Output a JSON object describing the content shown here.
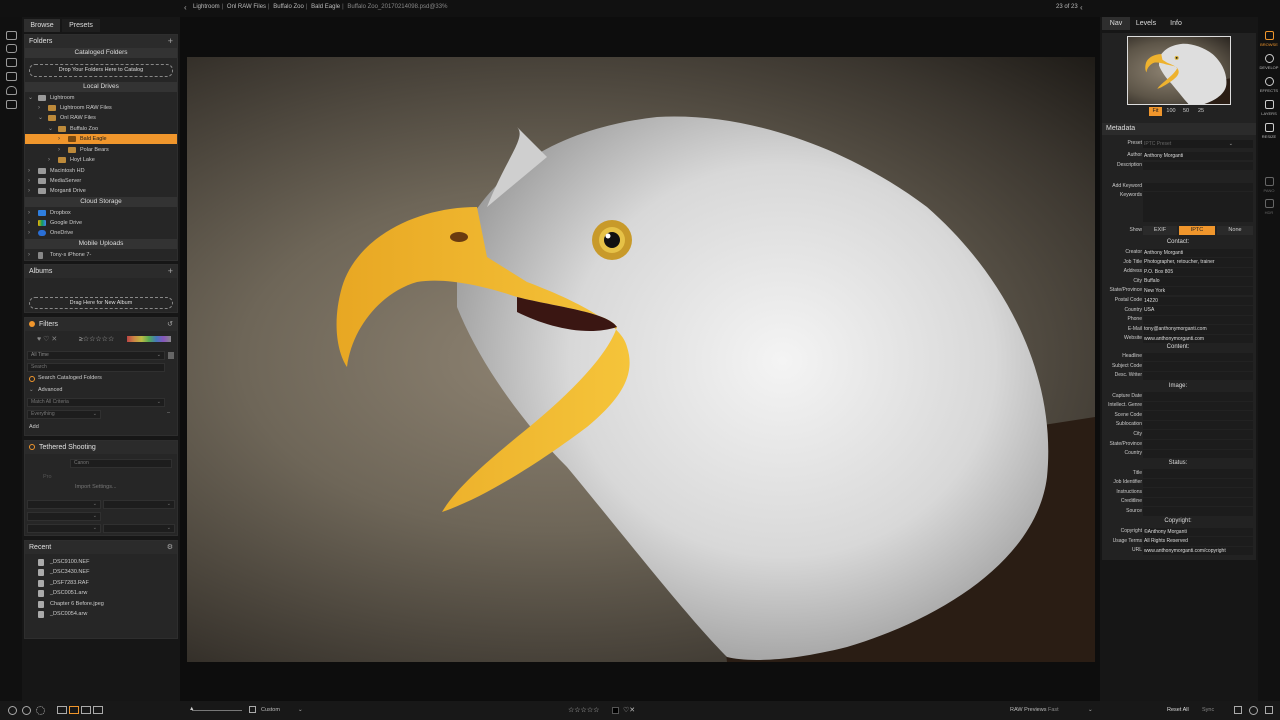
{
  "topbar": {
    "crumbs": [
      "Lightroom",
      "Onl RAW Files",
      "Buffalo Zoo",
      "Bald Eagle"
    ],
    "file": "Buffalo Zoo_20170214098.psd@33%",
    "counter": "23 of 23"
  },
  "left": {
    "tabs": [
      "Browse",
      "Presets"
    ],
    "folders": {
      "title": "Folders",
      "cataloged": "Cataloged Folders",
      "drop_catalog": "Drop Your Folders Here to Catalog",
      "local": "Local Drives",
      "tree": [
        {
          "label": "Lightroom"
        },
        {
          "label": "Lightroom RAW Files"
        },
        {
          "label": "Onl RAW Files"
        },
        {
          "label": "Buffalo Zoo"
        },
        {
          "label": "Bald Eagle"
        },
        {
          "label": "Polar Bears"
        },
        {
          "label": "Hoyt Lake"
        },
        {
          "label": "Macintosh HD"
        },
        {
          "label": "MediaServer"
        },
        {
          "label": "Morganti Drive"
        }
      ],
      "cloud": "Cloud Storage",
      "cloud_items": [
        {
          "label": "Dropbox"
        },
        {
          "label": "Google Drive"
        },
        {
          "label": "OneDrive"
        }
      ],
      "mobile": "Mobile Uploads",
      "mobile_items": [
        {
          "label": "Tony-s iPhone 7-"
        }
      ]
    },
    "albums": {
      "title": "Albums",
      "drop": "Drag Here for New Album"
    },
    "filters": {
      "title": "Filters",
      "rating": "≥☆☆☆☆☆",
      "time": "All Time",
      "search_placeholder": "Search",
      "search_cataloged": "Search Cataloged Folders",
      "advanced": "Advanced",
      "match": "Match All Criteria",
      "everything": "Everything",
      "add": "Add"
    },
    "tethered": {
      "title": "Tethered Shooting",
      "camera": "Canon",
      "import": "Import Settings..."
    },
    "recent": {
      "title": "Recent",
      "items": [
        "_DSC9100.NEF",
        "_DSC3430.NEF",
        "_DSF7283.RAF",
        "_DSC0051.arw",
        "Chapter 6 Before.jpeg",
        "_DSC0054.arw"
      ]
    }
  },
  "right": {
    "tabs": [
      "Nav",
      "Levels",
      "Info"
    ],
    "zoom": [
      "Fit",
      "100",
      "50",
      "25"
    ],
    "metadata_title": "Metadata",
    "preset_label": "Preset",
    "preset_value": "IPTC Preset",
    "top_fields": [
      {
        "k": "Author",
        "v": "Anthony Morganti"
      },
      {
        "k": "Description",
        "v": ""
      },
      {
        "k": "Add Keyword",
        "v": ""
      },
      {
        "k": "Keywords",
        "v": ""
      }
    ],
    "show_label": "Show",
    "show_opts": [
      "EXIF",
      "IPTC",
      "None"
    ],
    "contact_title": "Contact:",
    "contact": [
      {
        "k": "Creator",
        "v": "Anthony Morganti"
      },
      {
        "k": "Job Title",
        "v": "Photographer, retoucher, trainer"
      },
      {
        "k": "Address",
        "v": "P.O. Box 805"
      },
      {
        "k": "City",
        "v": "Buffalo"
      },
      {
        "k": "State/Province",
        "v": "New York"
      },
      {
        "k": "Postal Code",
        "v": "14220"
      },
      {
        "k": "Country",
        "v": "USA"
      },
      {
        "k": "Phone",
        "v": ""
      },
      {
        "k": "E-Mail",
        "v": "tony@anthonymorganti.com"
      },
      {
        "k": "Website",
        "v": "www.anthonymorganti.com"
      }
    ],
    "content_title": "Content:",
    "content": [
      {
        "k": "Headline",
        "v": ""
      },
      {
        "k": "Subject Code",
        "v": ""
      },
      {
        "k": "Desc. Writer",
        "v": ""
      }
    ],
    "image_title": "Image:",
    "image": [
      {
        "k": "Capture Date",
        "v": ""
      },
      {
        "k": "Intellect. Genre",
        "v": ""
      },
      {
        "k": "Scene Code",
        "v": ""
      },
      {
        "k": "Sublocation",
        "v": ""
      },
      {
        "k": "City",
        "v": ""
      },
      {
        "k": "State/Province",
        "v": ""
      },
      {
        "k": "Country",
        "v": ""
      }
    ],
    "status_title": "Status:",
    "status": [
      {
        "k": "Title",
        "v": ""
      },
      {
        "k": "Job Identifier",
        "v": ""
      },
      {
        "k": "Instructions",
        "v": ""
      },
      {
        "k": "Creditline",
        "v": ""
      },
      {
        "k": "Source",
        "v": ""
      }
    ],
    "copyright_title": "Copyright:",
    "copyright": [
      {
        "k": "Copyright",
        "v": "©Anthony Morganti"
      },
      {
        "k": "Usage Terms",
        "v": "All Rights Reserved"
      },
      {
        "k": "URL",
        "v": "www.anthonymorganti.com/copyright"
      }
    ]
  },
  "modules": [
    {
      "label": "BROWSE",
      "icon": "browse-icon"
    },
    {
      "label": "DEVELOP",
      "icon": "develop-icon"
    },
    {
      "label": "EFFECTS",
      "icon": "effects-icon"
    },
    {
      "label": "LAYERS",
      "icon": "layers-icon"
    },
    {
      "label": "RESIZE",
      "icon": "resize-icon"
    },
    {
      "label": "PANO",
      "icon": "pano-icon"
    },
    {
      "label": "HDR",
      "icon": "hdr-icon"
    }
  ],
  "bottom": {
    "sort": "Custom",
    "rating": "☆☆☆☆☆",
    "raw_previews": "RAW Previews",
    "raw_mode": "Fast",
    "reset_all": "Reset All",
    "sync": "Sync"
  },
  "colors": {
    "accent": "#f0962c",
    "panel": "#262626"
  }
}
